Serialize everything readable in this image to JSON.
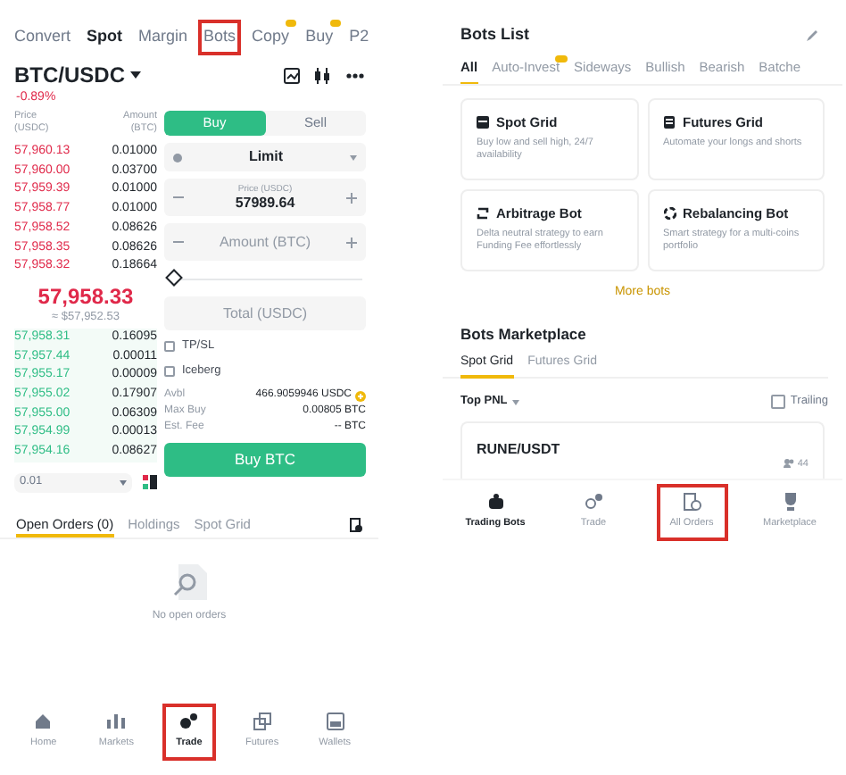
{
  "left_screen": {
    "top_tabs": [
      {
        "label": "Convert",
        "selected": false,
        "highlighted": false,
        "badge": false
      },
      {
        "label": "Spot",
        "selected": true,
        "highlighted": false,
        "badge": false
      },
      {
        "label": "Margin",
        "selected": false,
        "highlighted": false,
        "badge": false
      },
      {
        "label": "Bots",
        "selected": false,
        "highlighted": true,
        "badge": false
      },
      {
        "label": "Copy",
        "selected": false,
        "highlighted": false,
        "badge": true
      },
      {
        "label": "Buy",
        "selected": false,
        "highlighted": false,
        "badge": true
      },
      {
        "label": "P2",
        "selected": false,
        "highlighted": false,
        "badge": false
      }
    ],
    "pair": {
      "symbol": "BTC/USDC",
      "change": "-0.89%"
    },
    "order_book": {
      "price_header": "Price (USDC)",
      "amount_header": "Amount (BTC)",
      "asks": [
        {
          "price": "57,960.13",
          "amount": "0.01000"
        },
        {
          "price": "57,960.00",
          "amount": "0.03700"
        },
        {
          "price": "57,959.39",
          "amount": "0.01000"
        },
        {
          "price": "57,958.77",
          "amount": "0.01000"
        },
        {
          "price": "57,958.52",
          "amount": "0.08626"
        },
        {
          "price": "57,958.35",
          "amount": "0.08626"
        },
        {
          "price": "57,958.32",
          "amount": "0.18664"
        }
      ],
      "last_price": "57,958.33",
      "fiat_price": "≈ $57,952.53",
      "bids": [
        {
          "price": "57,958.31",
          "amount": "0.16095"
        },
        {
          "price": "57,957.44",
          "amount": "0.00011"
        },
        {
          "price": "57,955.17",
          "amount": "0.00009"
        },
        {
          "price": "57,955.02",
          "amount": "0.17907"
        },
        {
          "price": "57,955.00",
          "amount": "0.06309"
        },
        {
          "price": "57,954.99",
          "amount": "0.00013"
        },
        {
          "price": "57,954.16",
          "amount": "0.08627"
        }
      ],
      "precision": "0.01"
    },
    "order_form": {
      "sides": [
        {
          "label": "Buy",
          "selected": true
        },
        {
          "label": "Sell",
          "selected": false
        }
      ],
      "order_type": "Limit",
      "price_label": "Price (USDC)",
      "price_value": "57989.64",
      "amount_placeholder": "Amount (BTC)",
      "slider": {
        "level": 0
      },
      "total_placeholder": "Total (USDC)",
      "options": [
        {
          "label": "TP/SL",
          "checked": false
        },
        {
          "label": "Iceberg",
          "checked": false
        }
      ],
      "info": [
        {
          "label": "Avbl",
          "value": "466.9059946 USDC"
        },
        {
          "label": "Max Buy",
          "value": "0.00805 BTC"
        },
        {
          "label": "Est. Fee",
          "value": "-- BTC"
        }
      ],
      "submit": "Buy BTC"
    },
    "orders_tabs": [
      {
        "label": "Open Orders (0)",
        "selected": true
      },
      {
        "label": "Holdings",
        "selected": false
      },
      {
        "label": "Spot Grid",
        "selected": false
      }
    ],
    "empty_message": "No open orders",
    "bottom_nav": [
      {
        "label": "Home",
        "selected": false,
        "highlighted": false
      },
      {
        "label": "Markets",
        "selected": false,
        "highlighted": false
      },
      {
        "label": "Trade",
        "selected": true,
        "highlighted": true
      },
      {
        "label": "Futures",
        "selected": false,
        "highlighted": false
      },
      {
        "label": "Wallets",
        "selected": false,
        "highlighted": false
      }
    ]
  },
  "right_screen": {
    "title": "Bots List",
    "filters": [
      {
        "label": "All",
        "selected": true,
        "badge": false
      },
      {
        "label": "Auto-Invest",
        "selected": false,
        "badge": true
      },
      {
        "label": "Sideways",
        "selected": false,
        "badge": false
      },
      {
        "label": "Bullish",
        "selected": false,
        "badge": false
      },
      {
        "label": "Bearish",
        "selected": false,
        "badge": false
      },
      {
        "label": "Batche",
        "selected": false,
        "badge": false
      }
    ],
    "bot_cards": [
      {
        "title": "Spot Grid",
        "description": "Buy low and sell high, 24/7 availability"
      },
      {
        "title": "Futures Grid",
        "description": "Automate your longs and shorts"
      },
      {
        "title": "Arbitrage Bot",
        "description": "Delta neutral strategy to earn Funding Fee effortlessly"
      },
      {
        "title": "Rebalancing Bot",
        "description": "Smart strategy for a multi-coins portfolio"
      }
    ],
    "more_link": "More bots",
    "marketplace_title": "Bots Marketplace",
    "marketplace_tabs": [
      {
        "label": "Spot Grid",
        "selected": true
      },
      {
        "label": "Futures Grid",
        "selected": false
      }
    ],
    "sort": "Top PNL",
    "trailing": {
      "label": "Trailing",
      "checked": false
    },
    "market_card": {
      "pair": "RUNE/USDT",
      "users": "44"
    },
    "bottom_nav": [
      {
        "label": "Trading Bots",
        "selected": true,
        "highlighted": false
      },
      {
        "label": "Trade",
        "selected": false,
        "highlighted": false
      },
      {
        "label": "All Orders",
        "selected": false,
        "highlighted": true
      },
      {
        "label": "Marketplace",
        "selected": false,
        "highlighted": false
      }
    ]
  }
}
